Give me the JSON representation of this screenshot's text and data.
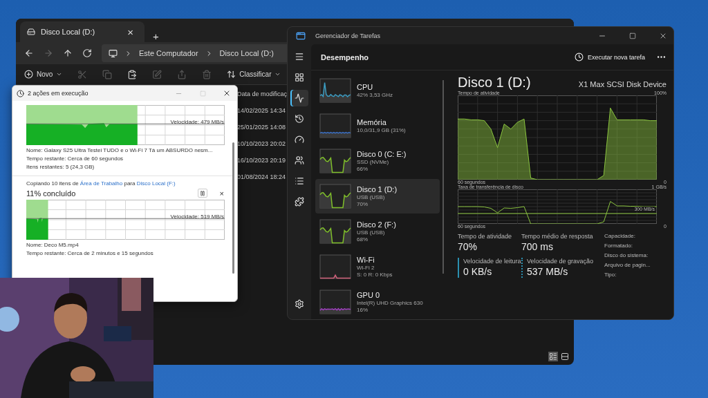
{
  "explorer": {
    "tab": {
      "title": "Disco Local (D:)",
      "close": "×",
      "selected": true
    },
    "new_tab": "+",
    "nav": [
      {
        "kind": "back",
        "disabled": false
      },
      {
        "kind": "forward",
        "disabled": true
      },
      {
        "kind": "up",
        "disabled": false
      },
      {
        "kind": "refresh",
        "disabled": false
      }
    ],
    "breadcrumb": [
      "Este Computador",
      "Disco Local (D:)"
    ],
    "new_button": "Novo",
    "tools": [
      {
        "kind": "cut",
        "disabled": true
      },
      {
        "kind": "copy",
        "disabled": true
      },
      {
        "kind": "paste",
        "disabled": false
      },
      {
        "kind": "rename",
        "disabled": true
      },
      {
        "kind": "share",
        "disabled": true
      },
      {
        "kind": "delete",
        "disabled": true
      }
    ],
    "sort_button": "Classificar",
    "column_header": "Data de modificaç",
    "dates": [
      "14/02/2025 14:34",
      "25/01/2025 14:08",
      "10/10/2023 20:02",
      "16/10/2023 20:19",
      "01/08/2024 18:24"
    ],
    "views": [
      {
        "kind": "details",
        "selected": true
      },
      {
        "kind": "tiles",
        "selected": false
      }
    ]
  },
  "copy_dialog": {
    "title": "2 ações em execução",
    "operations": [
      {
        "level": 0.56,
        "speed": "Velocidade: 479 MB/s",
        "details": [
          "Nome: Galaxy S25 Ultra Testei TUDO e o Wi-Fi 7 Tá um ABSURDO nesm...",
          "Tempo restante: Cerca de 60 segundos",
          "Itens restantes: 5 (24,3 GB)"
        ]
      },
      {
        "header": {
          "prefix": "Copiando 10 itens de",
          "source": "Área de Trabalho",
          "middle": "para",
          "destination": "Disco Local (F:)"
        },
        "percent": "11% concluído",
        "close": "×",
        "level": 0.11,
        "speed": "Velocidade: 519 MB/s",
        "details": [
          "Nome: Deco M5.mp4",
          "Tempo restante: Cerca de 2 minutos e 15 segundos"
        ]
      }
    ]
  },
  "task_manager": {
    "title": "Gerenciador de Tarefas",
    "nav": [
      {
        "kind": "menu",
        "selected": false
      },
      {
        "kind": "processes",
        "selected": false
      },
      {
        "kind": "performance",
        "selected": true
      },
      {
        "kind": "history",
        "selected": false
      },
      {
        "kind": "startup",
        "selected": false
      },
      {
        "kind": "users",
        "selected": false
      },
      {
        "kind": "details",
        "selected": false
      },
      {
        "kind": "services",
        "selected": false
      },
      {
        "kind": "settings",
        "selected": false
      }
    ],
    "page_title": "Desempenho",
    "run_task": "Executar nova tarefa",
    "resources": [
      {
        "name": "CPU",
        "lines": [
          "42% 3,53 GHz"
        ],
        "color": "#3b9cc2",
        "selected": false
      },
      {
        "name": "Memória",
        "lines": [
          "10,0/31,9 GB (31%)"
        ],
        "color": "#3b6fc2",
        "selected": false
      },
      {
        "name": "Disco 0 (C: E:)",
        "lines": [
          "SSD (NVMe)",
          "66%"
        ],
        "color": "#7fbf2a",
        "selected": false
      },
      {
        "name": "Disco 1 (D:)",
        "lines": [
          "USB (USB)",
          "70%"
        ],
        "color": "#7fbf2a",
        "selected": true
      },
      {
        "name": "Disco 2 (F:)",
        "lines": [
          "USB (USB)",
          "68%"
        ],
        "color": "#7fbf2a",
        "selected": false
      },
      {
        "name": "Wi-Fi",
        "lines": [
          "Wi-Fi 2",
          "S: 0 R: 0 Kbps"
        ],
        "color": "#d0607a",
        "selected": false
      },
      {
        "name": "GPU 0",
        "lines": [
          "Intel(R) UHD Graphics 630",
          "16%"
        ],
        "color": "#a040c0",
        "selected": false
      }
    ],
    "detail": {
      "title": "Disco 1 (D:)",
      "device": "X1 Max SCSI Disk Device",
      "graphs": [
        {
          "kind": "area",
          "title": "Tempo de atividade",
          "top_label": "100%",
          "start_label": "60 segundos",
          "end_label": "0"
        },
        {
          "kind": "line",
          "title": "Taxa de transferência de disco",
          "top_label": "1 GB/s",
          "scale_label": "300 MB/s",
          "start_label": "60 segundos",
          "end_label": "0"
        }
      ],
      "stats": [
        {
          "label": "Tempo de atividade",
          "value": "70%"
        },
        {
          "label": "Tempo médio de resposta",
          "value": "700 ms"
        }
      ],
      "speeds": [
        {
          "kind": "read",
          "label": "Velocidade de leitura",
          "value": "0 KB/s"
        },
        {
          "kind": "write",
          "label": "Velocidade de gravação",
          "value": "537 MB/s"
        }
      ],
      "properties": [
        "Capacidade:",
        "Formatado:",
        "Disco do sistema:",
        "Arquivo de pagin...",
        "Tipo:"
      ]
    }
  }
}
